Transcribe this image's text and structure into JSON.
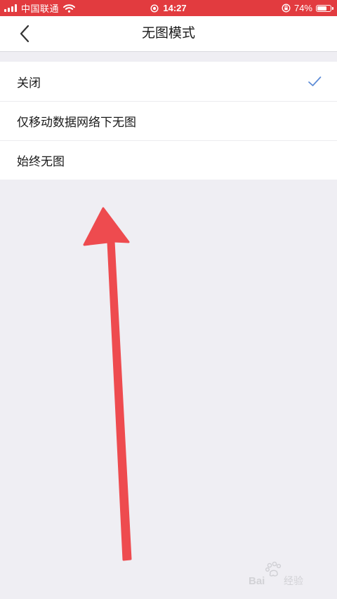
{
  "status_bar": {
    "carrier": "中国联通",
    "time": "14:27",
    "battery_percent": "74%",
    "battery_level": 0.74
  },
  "nav": {
    "title": "无图模式",
    "back_icon": "chevron-left-icon"
  },
  "options": [
    {
      "label": "关闭",
      "selected": true
    },
    {
      "label": "仅移动数据网络下无图",
      "selected": false
    },
    {
      "label": "始终无图",
      "selected": false
    }
  ],
  "colors": {
    "status_bar": "#e23b3f",
    "check": "#5b8ad6",
    "annotation_arrow": "#ee4b4f",
    "background": "#efeef3"
  },
  "watermark": {
    "brand": "Baidu经验"
  }
}
